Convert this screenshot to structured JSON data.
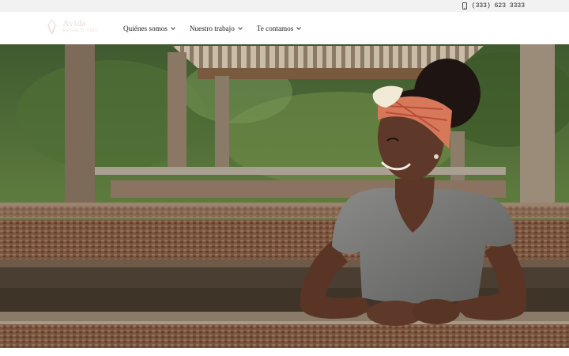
{
  "topbar": {
    "phone_icon": "phone-icon",
    "phone": "(333) 623 3333"
  },
  "header": {
    "logo": {
      "name": "Avida",
      "subtitle": "REGALO·TIET"
    },
    "nav": [
      {
        "label": "Quiénes somos",
        "icon": "chevron-down-icon"
      },
      {
        "label": "Nuestro trabajo",
        "icon": "chevron-down-icon"
      },
      {
        "label": "Te contamos",
        "icon": "chevron-down-icon"
      }
    ]
  },
  "hero": {
    "image_subject": "woman-at-cacao-drying-beds"
  },
  "colors": {
    "topbar_bg": "#f2f2f2",
    "nav_bg": "#ffffff",
    "text": "#222222",
    "logo": "#e7d9d4"
  }
}
